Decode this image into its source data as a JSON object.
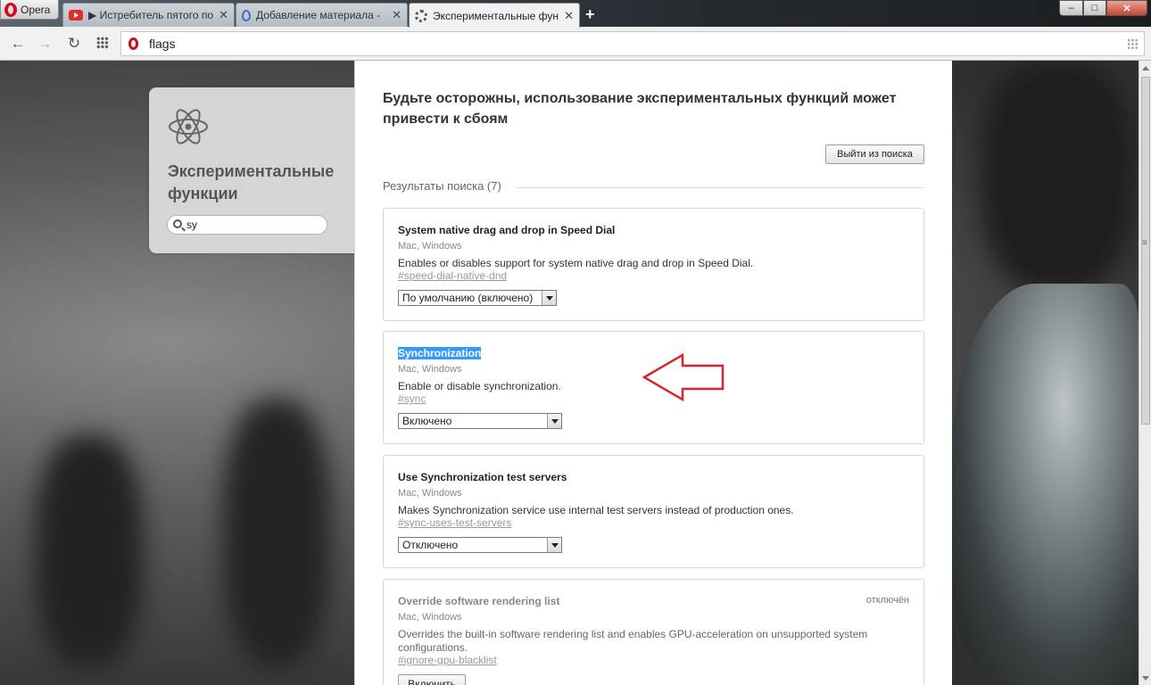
{
  "browser": {
    "menu_label": "Opera",
    "tabs": [
      {
        "label": "▶ Истребитель пятого по",
        "favicon": "youtube-icon"
      },
      {
        "label": "Добавление материала -",
        "favicon": "drop-icon"
      },
      {
        "label": "Экспериментальные фун",
        "favicon": "gear-icon"
      }
    ],
    "new_tab": "+",
    "window_controls": {
      "minimize": "–",
      "maximize": "□",
      "close": "✕"
    },
    "address": "flags",
    "accent": "#cc0f16"
  },
  "sidebar": {
    "icon": "atom-icon",
    "title": "Экспериментальные функции",
    "search_value": "sy"
  },
  "main": {
    "warning": "Будьте осторожны, использование экспериментальных функций может привести к сбоям",
    "exit_search_label": "Выйти из поиска",
    "results_header": "Результаты поиска (7)",
    "flags": [
      {
        "name": "System native drag and drop in Speed Dial",
        "platforms": "Mac, Windows",
        "description": "Enables or disables support for system native drag and drop in Speed Dial.",
        "anchor": "#speed-dial-native-dnd",
        "selected": "По умолчанию (включено)"
      },
      {
        "name": "Synchronization",
        "platforms": "Mac, Windows",
        "description": "Enable or disable synchronization.",
        "anchor": "#sync",
        "selected": "Включено"
      },
      {
        "name": "Use Synchronization test servers",
        "platforms": "Mac, Windows",
        "description": "Makes Synchronization service use internal test servers instead of production ones.",
        "anchor": "#sync-uses-test-servers",
        "selected": "Отключено"
      },
      {
        "name": "Override software rendering list",
        "platforms": "Mac, Windows",
        "description": "Overrides the built-in software rendering list and enables GPU-acceleration on unsupported system configurations.",
        "anchor": "#ignore-gpu-blacklist",
        "status": "отключён",
        "button": "Включить"
      }
    ]
  },
  "colors": {
    "highlight": "#3399ff",
    "annotation_arrow": "#d7262b"
  }
}
